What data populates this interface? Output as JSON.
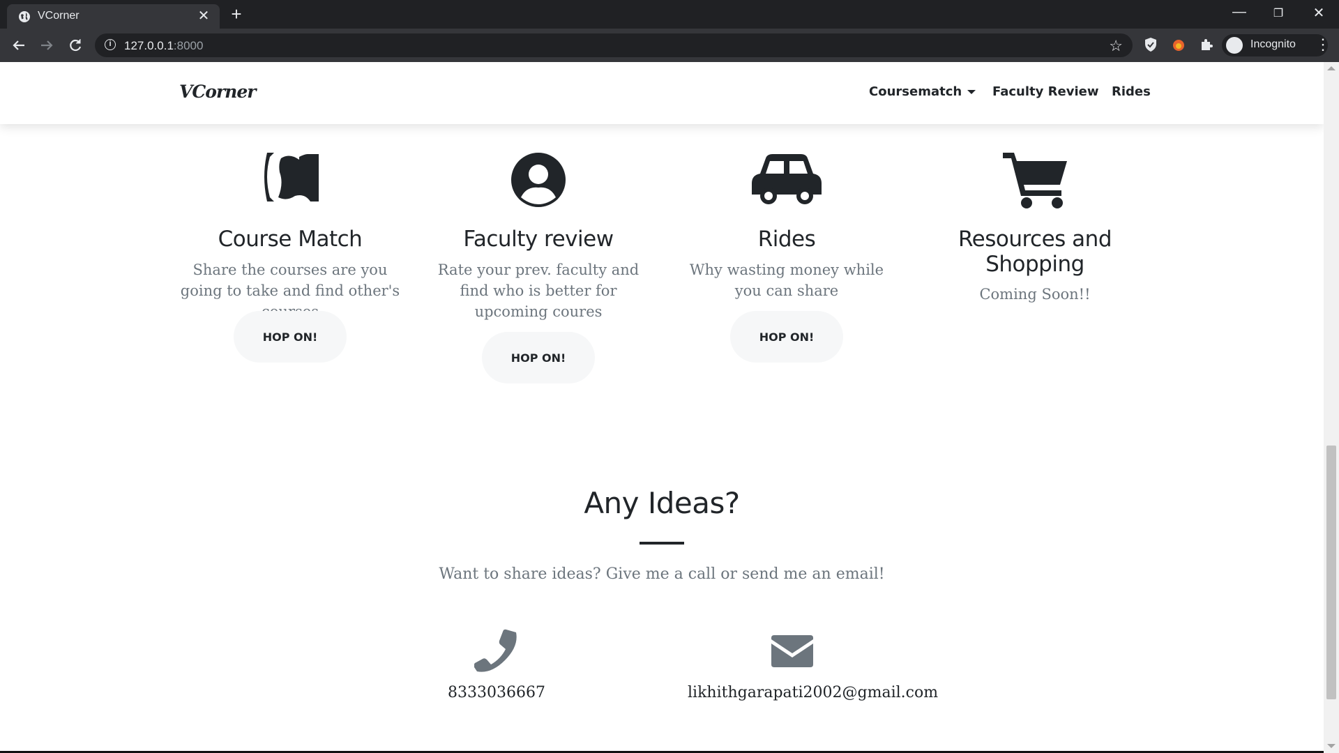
{
  "browser": {
    "tab_title": "VCorner",
    "url_host": "127.0.0.1",
    "url_port": ":8000",
    "profile_label": "Incognito"
  },
  "nav": {
    "brand": "VCorner",
    "links": [
      "Coursematch",
      "Faculty Review",
      "Rides"
    ]
  },
  "features": [
    {
      "title": "Course Match",
      "description": "Share the courses are you going to take and find other's courses",
      "button": "HOP ON!",
      "icon": "course-match-logo-icon"
    },
    {
      "title": "Faculty review",
      "description": "Rate your prev. faculty and find who is better for upcoming coures",
      "button": "HOP ON!",
      "icon": "user-circle-icon"
    },
    {
      "title": "Rides",
      "description": "Why wasting money while you can share",
      "button": "HOP ON!",
      "icon": "car-icon"
    },
    {
      "title": "Resources and Shopping",
      "description": "Coming Soon!!",
      "icon": "shopping-cart-icon"
    }
  ],
  "ideas": {
    "title": "Any Ideas?",
    "subtitle": "Want to share ideas? Give me a call or send me an email!",
    "phone": "8333036667",
    "email": "likhithgarapati2002@gmail.com"
  },
  "colors": {
    "text_dark": "#212529",
    "text_muted": "#6c757d",
    "icon_muted": "#6c757d"
  }
}
